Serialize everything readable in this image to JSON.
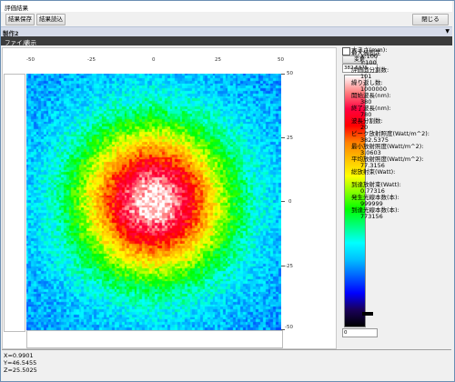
{
  "window": {
    "title": "評価結果"
  },
  "toolbar": {
    "save_label": "結果保存",
    "load_label": "結果読込",
    "close_label": "閉じる"
  },
  "tab": {
    "label": "製作2"
  },
  "menu": {
    "file": "ファイル",
    "view": "表示"
  },
  "plot": {
    "x_ticks": [
      "-50",
      "-25",
      "0",
      "25",
      "50"
    ],
    "y_ticks": [
      "50",
      "25",
      "0",
      "-25",
      "-50"
    ]
  },
  "colorbar": {
    "checkbox_label": "最大値固定",
    "max_value": "382.5375",
    "apply_label": "変更",
    "min_value": "0",
    "palette": [
      "#000000",
      "#1a005a",
      "#0000ff",
      "#0060ff",
      "#00c0ff",
      "#00ffff",
      "#00ff80",
      "#00ff00",
      "#80ff00",
      "#ffff00",
      "#ffc000",
      "#ff8000",
      "#ff0000",
      "#ff0040",
      "#ff8080",
      "#ffffff"
    ]
  },
  "info": {
    "size_label": "大きさ(mm):",
    "size_x": "X:100",
    "size_y": "Y:100",
    "divisions_label": "評価面分割数:",
    "divisions_value": "101",
    "repeats_label": "繰り返し数:",
    "repeats_value": "1000000",
    "start_wl_label": "開始波長(nm):",
    "start_wl_value": "380",
    "end_wl_label": "終了波長(nm):",
    "end_wl_value": "780",
    "wl_div_label": "波長分割数:",
    "wl_div_value": "20",
    "peak_label": "ピーク放射照度(Watt/m^2):",
    "peak_value": "382.5375",
    "min_label": "最小放射照度(Watt/m^2):",
    "min_value": "3.0603",
    "avg_label": "平均放射照度(Watt/m^2):",
    "avg_value": "77.3156",
    "total_label": "総放射束(Watt):",
    "total_value": "",
    "arrived_label": "到達放射束(Watt):",
    "arrived_value": "0.77316",
    "emitted_label": "発生光線本数(本):",
    "emitted_value": "999999",
    "arrived_rays_label": "到達光線本数(本):",
    "arrived_rays_value": "773156"
  },
  "status": {
    "x": "X=0.9901",
    "y": "Y=46.5455",
    "z": "Z=25.5025"
  }
}
